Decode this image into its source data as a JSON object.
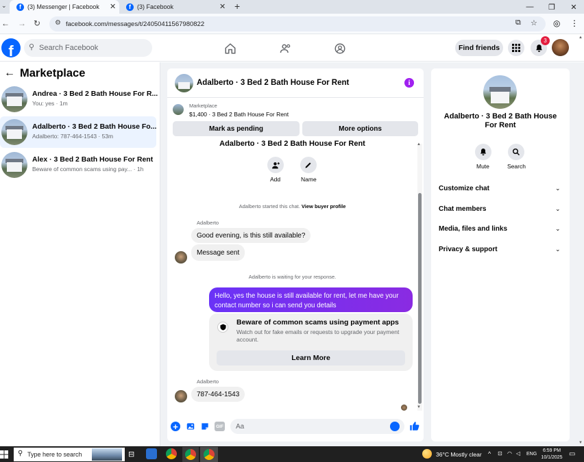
{
  "browser": {
    "tabs": [
      {
        "title": "(3) Messenger | Facebook"
      },
      {
        "title": "(3) Facebook"
      }
    ],
    "url": "facebook.com/messages/t/24050411567980822"
  },
  "header": {
    "search_placeholder": "Search Facebook",
    "find_friends": "Find friends",
    "notification_count": "3"
  },
  "sidebar": {
    "title": "Marketplace",
    "conversations": [
      {
        "name": "Andrea · 3 Bed 2 Bath House For R...",
        "preview": "You: yes · 1m"
      },
      {
        "name": "Adalberto · 3 Bed 2 Bath House Fo...",
        "preview": "Adalberto: 787-464-1543 · 53m"
      },
      {
        "name": "Alex · 3 Bed 2 Bath House For Rent",
        "preview": "Beware of common scams using pay...",
        "time": "· 1h"
      }
    ]
  },
  "chat": {
    "title": "Adalberto · 3 Bed 2 Bath House For Rent",
    "listing_label": "Marketplace",
    "listing_detail": "$1,400 · 3 Bed 2 Bath House For Rent",
    "mark_pending": "Mark as pending",
    "more_options": "More options",
    "cut_title": "Adalberto · 3 Bed 2 Bath House For Rent",
    "add_label": "Add",
    "name_label": "Name",
    "started_text": "Adalberto started this chat.",
    "view_profile": "View buyer profile",
    "sender_name": "Adalberto",
    "msg1": "Good evening, is this still available?",
    "msg2": "Message sent",
    "waiting_text": "Adalberto is waiting for your response.",
    "my_msg_line1": "Hello, yes the house is still available for rent, let me have your",
    "my_msg_line2": "contact number so i can send you  details",
    "scam_title": "Beware of common scams using payment apps",
    "scam_line1": "Watch out for fake emails or requests to upgrade your payment",
    "scam_line2": "account.",
    "learn_more": "Learn More",
    "sender_name2": "Adalberto",
    "msg3": "787-464-1543",
    "composer_placeholder": "Aa"
  },
  "info_panel": {
    "title_line1": "Adalberto · 3 Bed 2 Bath House",
    "title_line2": "For Rent",
    "mute": "Mute",
    "search": "Search",
    "sections": [
      "Customize chat",
      "Chat members",
      "Media, files and links",
      "Privacy & support"
    ]
  },
  "taskbar": {
    "search_placeholder": "Type here to search",
    "weather": "36°C  Mostly clear",
    "lang": "ENG",
    "time": "6:59 PM",
    "date": "10/1/2025"
  },
  "colors": {
    "accent": "#0866ff",
    "my_bubble": "#7b2ff7",
    "info_icon": "#a020f0"
  }
}
